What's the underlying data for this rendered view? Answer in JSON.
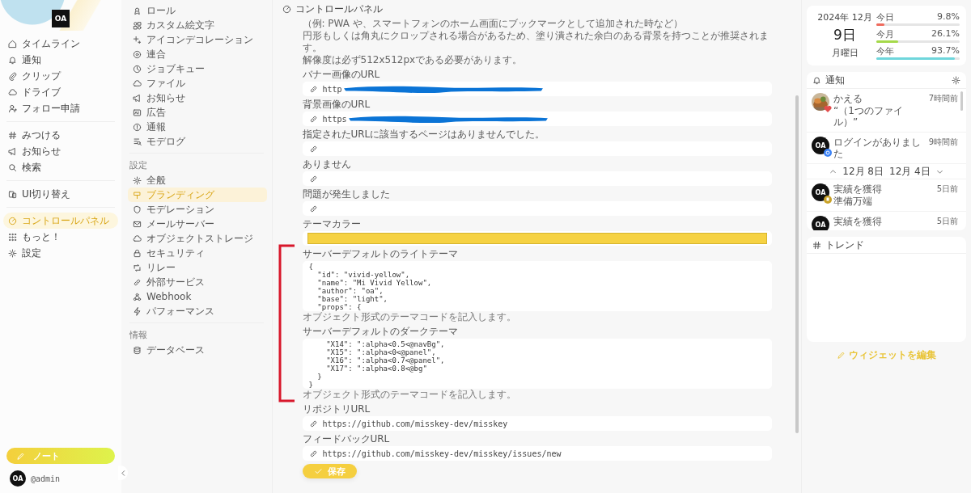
{
  "nav": {
    "logo_text": "OA",
    "groups": [
      {
        "items": [
          {
            "label": "タイムライン",
            "selected": false
          },
          {
            "label": "通知",
            "selected": false
          },
          {
            "label": "クリップ",
            "selected": false
          },
          {
            "label": "ドライブ",
            "selected": false
          },
          {
            "label": "フォロー申請",
            "selected": false
          }
        ]
      },
      {
        "items": [
          {
            "label": "みつける",
            "selected": false
          },
          {
            "label": "お知らせ",
            "selected": false
          },
          {
            "label": "検索",
            "selected": false
          }
        ]
      },
      {
        "items": [
          {
            "label": "UI切り替え",
            "selected": false
          }
        ]
      },
      {
        "items": [
          {
            "label": "コントロールパネル",
            "selected": true
          },
          {
            "label": "もっと！",
            "selected": false
          },
          {
            "label": "設定",
            "selected": false
          }
        ]
      }
    ],
    "note_button": "ノート",
    "account": {
      "avatar_text": "OA",
      "handle": "@admin"
    }
  },
  "admin_menu": {
    "sections": [
      {
        "items": [
          {
            "label": "ロール",
            "selected": false
          },
          {
            "label": "カスタム絵文字",
            "selected": false
          },
          {
            "label": "アイコンデコレーション",
            "selected": false
          },
          {
            "label": "連合",
            "selected": false
          },
          {
            "label": "ジョブキュー",
            "selected": false
          },
          {
            "label": "ファイル",
            "selected": false
          },
          {
            "label": "お知らせ",
            "selected": false
          },
          {
            "label": "広告",
            "selected": false
          },
          {
            "label": "通報",
            "selected": false
          },
          {
            "label": "モデログ",
            "selected": false
          }
        ]
      },
      {
        "title": "設定",
        "items": [
          {
            "label": "全般",
            "selected": false
          },
          {
            "label": "ブランディング",
            "selected": true
          },
          {
            "label": "モデレーション",
            "selected": false
          },
          {
            "label": "メールサーバー",
            "selected": false
          },
          {
            "label": "オブジェクトストレージ",
            "selected": false
          },
          {
            "label": "セキュリティ",
            "selected": false
          },
          {
            "label": "リレー",
            "selected": false
          },
          {
            "label": "外部サービス",
            "selected": false
          },
          {
            "label": "Webhook",
            "selected": false
          },
          {
            "label": "パフォーマンス",
            "selected": false
          }
        ]
      },
      {
        "title": "情報",
        "items": [
          {
            "label": "データベース",
            "selected": false
          }
        ]
      }
    ]
  },
  "header": {
    "title": "コントロールパネル"
  },
  "form": {
    "description": [
      "（例: PWA や、スマートフォンのホーム画面にブックマークとして追加された時など）",
      "円形もしくは角丸にクロップされる場合があるため、塗り潰された余白のある背景を持つことが推奨されます。",
      "解像度は必ず512x512pxである必要があります。"
    ],
    "fields": [
      {
        "kind": "url",
        "label": "バナー画像のURL",
        "value": "http",
        "redacted": true
      },
      {
        "kind": "url",
        "label": "背景画像のURL",
        "value": "https",
        "redacted": true
      },
      {
        "kind": "url",
        "label": "指定されたURLに該当するページはありませんでした。"
      },
      {
        "kind": "url",
        "label": "ありません"
      },
      {
        "kind": "url",
        "label": "問題が発生しました"
      },
      {
        "kind": "color",
        "label": "テーマカラー",
        "color": "#f6d243"
      },
      {
        "kind": "code",
        "label": "サーバーデフォルトのライトテーマ",
        "caption": "オブジェクト形式のテーマコードを記入します。",
        "lines": [
          "{",
          "  \"id\": \"vivid-yellow\",",
          "  \"name\": \"Mi Vivid Yellow\",",
          "  \"author\": \"oa\",",
          "  \"base\": \"light\",",
          "  \"props\": {"
        ]
      },
      {
        "kind": "code",
        "label": "サーバーデフォルトのダークテーマ",
        "caption": "オブジェクト形式のテーマコードを記入します。",
        "lines": [
          "    \"X14\": \":alpha<0.5<@navBg\",",
          "    \"X15\": \":alpha<0<@panel\",",
          "    \"X16\": \":alpha<0.7<@panel\",",
          "    \"X17\": \":alpha<0.8<@bg\"",
          "  }",
          "}"
        ]
      },
      {
        "kind": "url",
        "label": "リポジトリURL",
        "value": "https://github.com/misskey-dev/misskey"
      },
      {
        "kind": "url",
        "label": "フィードバックURL",
        "value": "https://github.com/misskey-dev/misskey/issues/new"
      }
    ],
    "annotation_bracket": true,
    "save_button": "保存"
  },
  "widgets": {
    "calendar": {
      "year_month": "2024年 12月",
      "day": "9日",
      "weekday": "月曜日",
      "bars": [
        {
          "label": "今日",
          "reading": "9.8%",
          "level": 0.098,
          "color": "#ef6b5e"
        },
        {
          "label": "今月",
          "reading": "26.1%",
          "level": 0.261,
          "color": "#a5d94a"
        },
        {
          "label": "今年",
          "reading": "93.7%",
          "level": 0.937,
          "color": "#6fd6dc"
        }
      ]
    },
    "notifications": {
      "title": "通知",
      "items": [
        {
          "kind": "reaction",
          "title": "かえる",
          "body": "“（1つのファイル）”",
          "time": "7時間前",
          "color": "#e34c4c"
        },
        {
          "kind": "login",
          "avatar_text": "OA",
          "title": "ログインがありました",
          "time": "9時間前",
          "color": "#3b82f6"
        }
      ],
      "date_range": [
        "12月 8日",
        "12月 4日"
      ],
      "items_after": [
        {
          "kind": "achievement",
          "avatar_text": "OA",
          "title": "実績を獲得",
          "body": "準備万端",
          "time": "5日前",
          "color": "#c9a227"
        },
        {
          "avatar_text": "OA",
          "title": "実績を獲得",
          "time": "5日前"
        }
      ]
    },
    "trends": {
      "title": "トレンド"
    },
    "edit_link": "ウィジェットを編集"
  }
}
